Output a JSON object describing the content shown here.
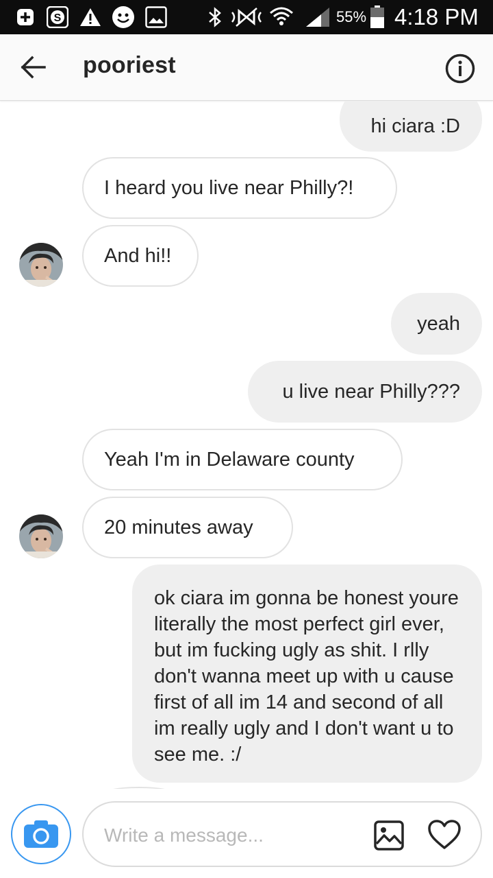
{
  "status_bar": {
    "icons": [
      "plus-square-icon",
      "skype-icon",
      "warning-icon",
      "smiley-icon",
      "image-icon",
      "bluetooth-icon",
      "nfc-icon",
      "wifi-icon",
      "signal-icon",
      "battery-icon"
    ],
    "battery": "55%",
    "time": "4:18 PM"
  },
  "header": {
    "title": "pooriest",
    "back_icon": "arrow-left-icon",
    "info_icon": "info-circle-icon"
  },
  "messages": [
    {
      "from": "me",
      "text": "hi ciara :D"
    },
    {
      "from": "them",
      "text": "I heard you live near Philly?!"
    },
    {
      "from": "them",
      "text": "And hi!!"
    },
    {
      "from": "me",
      "text": "yeah"
    },
    {
      "from": "me",
      "text": "u live near Philly???"
    },
    {
      "from": "them",
      "text": "Yeah I'm in Delaware county"
    },
    {
      "from": "them",
      "text": "20 minutes away"
    },
    {
      "from": "me",
      "text": "ok ciara im gonna be honest youre literally the most perfect girl ever, but im fucking ugly as shit. I rlly don't wanna meet up with u cause first of all im 14 and second of all im really ugly and I don't want u to see me. :/"
    }
  ],
  "composer": {
    "placeholder": "Write a message...",
    "camera_icon": "camera-icon",
    "gallery_icon": "gallery-icon",
    "like_icon": "heart-icon"
  },
  "colors": {
    "accent": "#3897f0",
    "outgoing_bubble": "#efefef",
    "incoming_border": "#e2e2e2",
    "status_bar": "#0d0d0d"
  }
}
